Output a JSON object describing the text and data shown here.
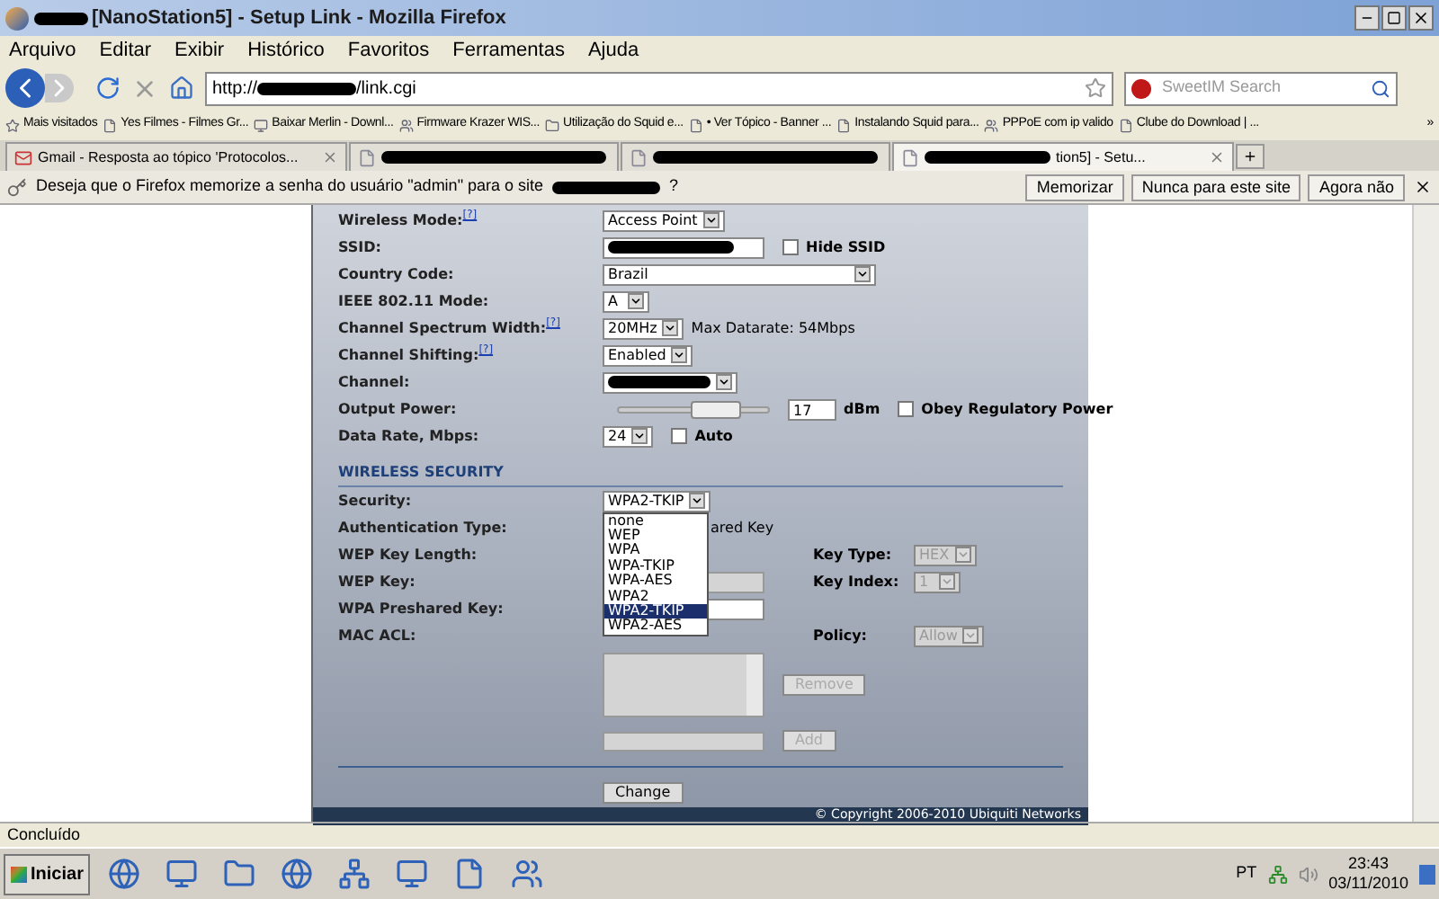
{
  "window": {
    "title": "[NanoStation5] - Setup Link - Mozilla Firefox"
  },
  "menu": [
    "Arquivo",
    "Editar",
    "Exibir",
    "Histórico",
    "Favoritos",
    "Ferramentas",
    "Ajuda"
  ],
  "address": {
    "scheme": "http://",
    "path": "/link.cgi"
  },
  "search": {
    "placeholder": "SweetIM Search"
  },
  "bookmarks": [
    "Mais visitados",
    "Yes Filmes - Filmes Gr...",
    "Baixar Merlin - Downl...",
    "Firmware Krazer WIS...",
    "Utilização do Squid e...",
    "• Ver Tópico - Banner ...",
    "Instalando Squid para...",
    "PPPoE com ip valido",
    "Clube do Download | ..."
  ],
  "bookmarks_more": "»",
  "tabs": [
    {
      "label": "Gmail - Resposta ao tópico 'Protocolos...",
      "selected": false
    },
    {
      "selected": false
    },
    {
      "selected": false
    },
    {
      "label": "tion5] - Setu...",
      "selected": true
    }
  ],
  "notification": {
    "text": "Deseja que o Firefox memorize a senha do usuário \"admin\" para o site",
    "end": "?",
    "buttons": [
      "Memorizar",
      "Nunca para este site",
      "Agora não"
    ]
  },
  "wireless": [
    {
      "label": "Wireless Mode:",
      "help": "[?]",
      "kind": "select",
      "value": "Access Point"
    },
    {
      "label": "SSID:",
      "kind": "text",
      "redacted": true,
      "checkbox": {
        "label": "Hide SSID",
        "checked": false
      }
    },
    {
      "label": "Country Code:",
      "kind": "wide-select",
      "value": "Brazil"
    },
    {
      "label": "IEEE 802.11 Mode:",
      "kind": "select",
      "value": "A"
    },
    {
      "label": "Channel Spectrum Width:",
      "help": "[?]",
      "kind": "select",
      "value": "20MHz",
      "note": "Max Datarate: 54Mbps"
    },
    {
      "label": "Channel Shifting:",
      "help": "[?]",
      "kind": "select",
      "value": "Enabled"
    },
    {
      "label": "Channel:",
      "kind": "select",
      "redacted": true
    },
    {
      "label": "Output Power:",
      "kind": "slider",
      "level": 0.65,
      "value": "17",
      "unit": "dBm",
      "checkbox": {
        "label": "Obey Regulatory Power",
        "checked": false
      }
    },
    {
      "label": "Data Rate, Mbps:",
      "kind": "select",
      "value": "24",
      "checkbox": {
        "label": "Auto",
        "checked": false
      }
    }
  ],
  "security": {
    "title": "WIRELESS SECURITY",
    "security_label": "Security:",
    "security_value": "WPA2-TKIP",
    "options": [
      {
        "label": "none",
        "selected": false
      },
      {
        "label": "WEP",
        "selected": false
      },
      {
        "label": "WPA",
        "selected": false
      },
      {
        "label": "WPA-TKIP",
        "selected": false
      },
      {
        "label": "WPA-AES",
        "selected": false
      },
      {
        "label": "WPA2",
        "selected": false
      },
      {
        "label": "WPA2-TKIP",
        "selected": true
      },
      {
        "label": "WPA2-AES",
        "selected": false
      }
    ],
    "auth_label": "Authentication Type:",
    "auth_value": "ared Key",
    "wep_length_label": "WEP Key Length:",
    "key_type_label": "Key Type:",
    "key_type_value": "HEX",
    "wep_key_label": "WEP Key:",
    "key_index_label": "Key Index:",
    "key_index_value": "1",
    "wpa_label": "WPA Preshared Key:",
    "mac_label": "MAC ACL:",
    "policy_label": "Policy:",
    "policy_value": "Allow",
    "remove": "Remove",
    "add": "Add",
    "change": "Change"
  },
  "footer": "© Copyright 2006-2010 Ubiquiti Networks",
  "status": "Concluído",
  "taskbar": {
    "start": "Iniciar",
    "lang": "PT",
    "time": "23:43",
    "date": "03/11/2010"
  }
}
